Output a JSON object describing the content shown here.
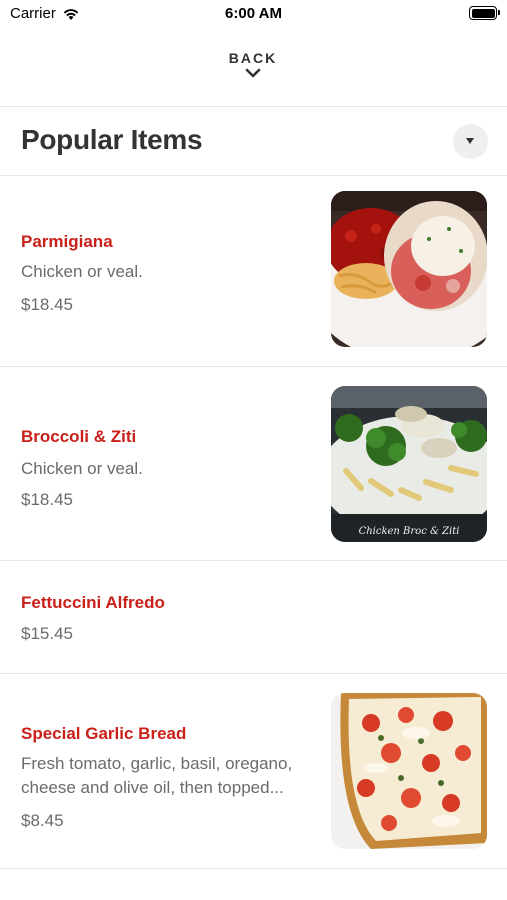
{
  "status_bar": {
    "carrier": "Carrier",
    "time": "6:00 AM",
    "wifi_icon": "wifi-icon",
    "battery_icon": "battery-icon"
  },
  "nav": {
    "back_label": "BACK",
    "chevron_icon": "chevron-down-icon"
  },
  "section": {
    "title": "Popular Items",
    "toggle_icon": "triangle-down-icon"
  },
  "colors": {
    "item_name": "#c9201a",
    "secondary_text": "#6b6b6b",
    "primary_text": "#333333",
    "divider": "#e8e8e8"
  },
  "items": [
    {
      "name": "Parmigiana",
      "description": "Chicken or veal.",
      "price": "$18.45",
      "image": "chicken-parmigiana-photo"
    },
    {
      "name": "Broccoli & Ziti",
      "description": "Chicken or veal.",
      "price": "$18.45",
      "image": "chicken-broccoli-ziti-photo",
      "image_caption": "Chicken Broc & Ziti"
    },
    {
      "name": "Fettuccini Alfredo",
      "price": "$15.45"
    },
    {
      "name": "Special Garlic Bread",
      "description": "Fresh tomato, garlic, basil, oregano, cheese and olive oil, then topped...",
      "price": "$8.45",
      "image": "garlic-bread-photo"
    }
  ]
}
